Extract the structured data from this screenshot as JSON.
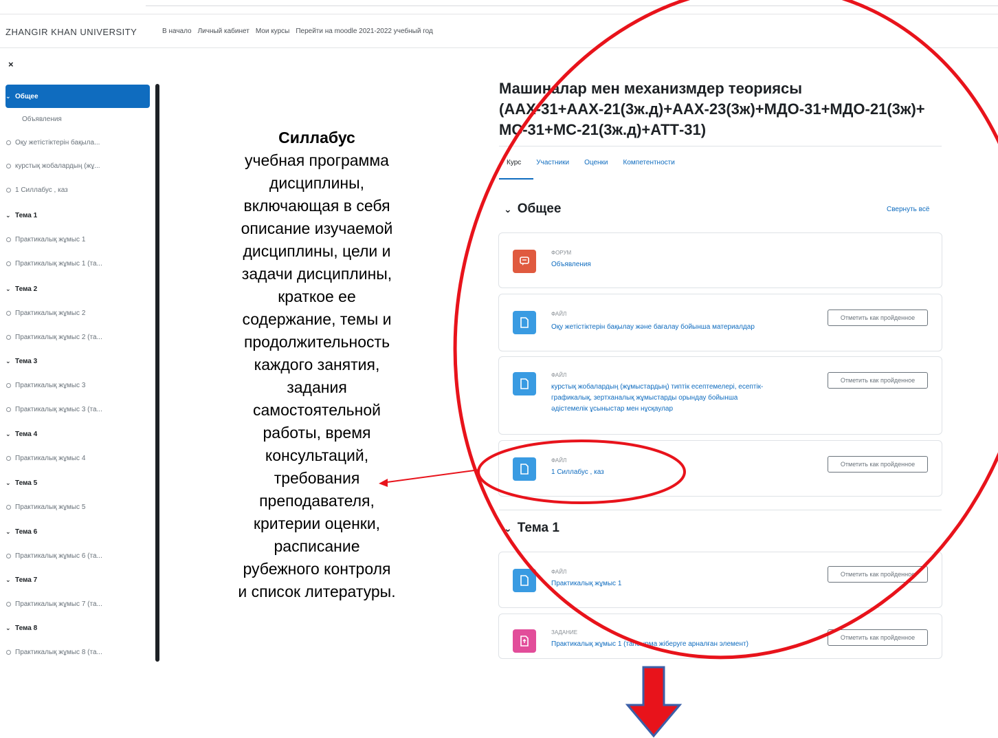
{
  "header": {
    "brand": "ZHANGIR KHAN UNIVERSITY",
    "nav": [
      "В начало",
      "Личный кабинет",
      "Мои курсы",
      "Перейти на moodle 2021-2022 учебный год"
    ]
  },
  "drawer": {
    "close": "×",
    "items": [
      {
        "label": "Общее",
        "type": "section",
        "active": true
      },
      {
        "label": "Объявления",
        "type": "plain"
      },
      {
        "label": "Оқу жетістіктерін бақыла...",
        "type": "activity"
      },
      {
        "label": "курстық жобалардың (жұ...",
        "type": "activity"
      },
      {
        "label": "1 Силлабус , каз",
        "type": "activity"
      },
      {
        "label": "Тема 1",
        "type": "section"
      },
      {
        "label": "Практикалық жұмыс 1",
        "type": "activity"
      },
      {
        "label": "Практикалық жұмыс 1 (та...",
        "type": "activity"
      },
      {
        "label": "Тема 2",
        "type": "section"
      },
      {
        "label": "Практикалық жұмыс 2",
        "type": "activity"
      },
      {
        "label": "Практикалық жұмыс 2 (та...",
        "type": "activity"
      },
      {
        "label": "Тема 3",
        "type": "section"
      },
      {
        "label": "Практикалық жұмыс 3",
        "type": "activity"
      },
      {
        "label": "Практикалық жұмыс 3 (та...",
        "type": "activity"
      },
      {
        "label": "Тема 4",
        "type": "section"
      },
      {
        "label": "Практикалық жұмыс 4",
        "type": "activity"
      },
      {
        "label": "Тема 5",
        "type": "section"
      },
      {
        "label": "Практикалық жұмыс 5",
        "type": "activity"
      },
      {
        "label": "Тема 6",
        "type": "section"
      },
      {
        "label": "Практикалық жұмыс 6 (та...",
        "type": "activity"
      },
      {
        "label": "Тема 7",
        "type": "section"
      },
      {
        "label": "Практикалық жұмыс 7 (та...",
        "type": "activity"
      },
      {
        "label": "Тема 8",
        "type": "section"
      },
      {
        "label": "Практикалық жұмыс 8 (та...",
        "type": "activity"
      }
    ]
  },
  "annotation": {
    "heading": "Силлабус",
    "lines": [
      "учебная программа",
      "дисциплины,",
      "включающая в себя",
      "описание изучаемой",
      "дисциплины, цели и",
      "задачи дисциплины,",
      "краткое ее",
      "содержание, темы и",
      "продолжительность",
      "каждого занятия,",
      "задания",
      "самостоятельной",
      "работы, время",
      "консультаций,",
      "требования",
      "преподавателя,",
      "критерии оценки,",
      "расписание",
      "рубежного контроля",
      "и список литературы."
    ]
  },
  "course": {
    "title_lines": [
      "Машиналар мен механизмдер теориясы",
      "(ААХ-31+ААХ-21(3ж.д)+ААХ-23(3ж)+МДО-31+МДО-21(3ж)+",
      "МС-31+МС-21(3ж.д)+АТТ-31)"
    ],
    "tabs": [
      "Курс",
      "Участники",
      "Оценки",
      "Компетентности"
    ],
    "collapse_all": "Свернуть всё",
    "mark_label": "Отметить как пройденное",
    "sections": [
      {
        "title": "Общее"
      },
      {
        "title": "Тема 1"
      }
    ],
    "activities": [
      {
        "kind": "ФОРУМ",
        "name_lines": [
          "Объявления"
        ],
        "icon": "forum-icon"
      },
      {
        "kind": "ФАЙЛ",
        "name_lines": [
          "Оқу жетістіктерін бақылау және бағалау бойынша материалдар"
        ],
        "icon": "file-icon"
      },
      {
        "kind": "ФАЙЛ",
        "name_lines": [
          "курстық жобалардың (жұмыстардың) типтік есептемелері, есептік-",
          "графикалық, зертханалық жұмыстарды орындау бойынша",
          "әдістемелік ұсыныстар мен нұсқаулар"
        ],
        "icon": "file-icon"
      },
      {
        "kind": "ФАЙЛ",
        "name_lines": [
          "1 Силлабус , каз"
        ],
        "icon": "file-icon"
      },
      {
        "kind": "ФАЙЛ",
        "name_lines": [
          "Практикалық жұмыс 1"
        ],
        "icon": "file-icon"
      },
      {
        "kind": "ЗАДАНИЕ",
        "name_lines": [
          "Практикалық жұмыс 1 (тапсырма жіберуге арналған элемент)"
        ],
        "icon": "assign-icon"
      }
    ]
  },
  "colors": {
    "accent": "#0f6cbf",
    "highlight": "#e8131b",
    "arrow_fill": "#e8131b",
    "arrow_outline": "#3b5fa8"
  }
}
